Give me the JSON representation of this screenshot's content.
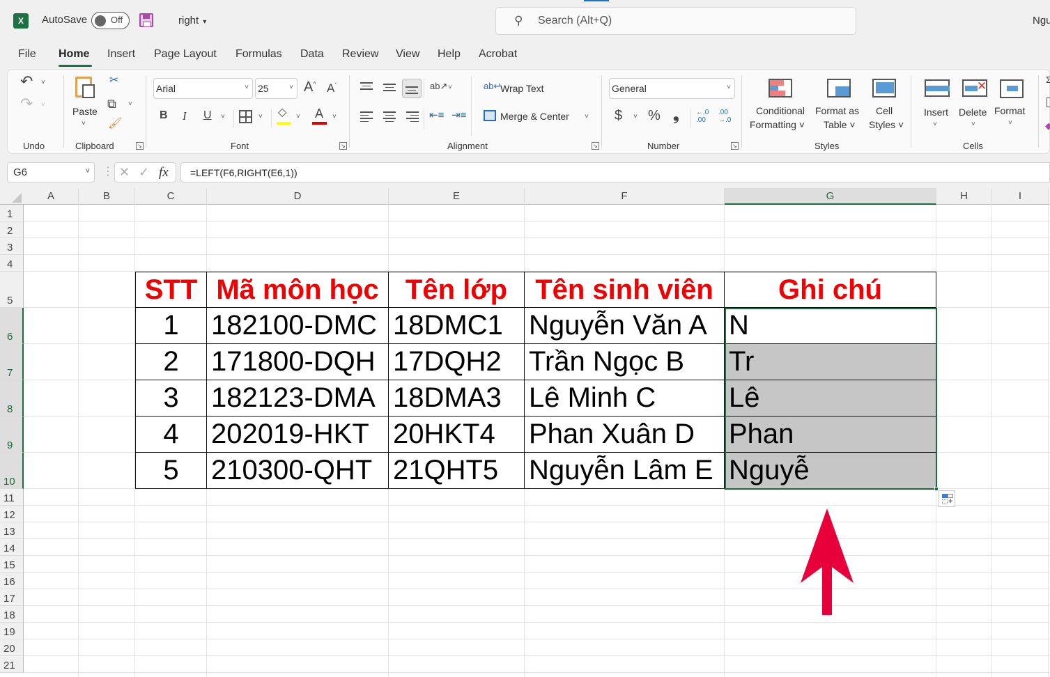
{
  "titlebar": {
    "app_icon": "excel-icon",
    "app_icon_letter": "X",
    "autosave_label": "AutoSave",
    "autosave_state": "Off",
    "save_icon": "save-icon",
    "document_name": "right",
    "document_caret": "▾",
    "search_placeholder": "Search (Alt+Q)",
    "search_icon": "⚲",
    "user_name": "Ngu"
  },
  "ribbon_tabs": [
    "File",
    "Home",
    "Insert",
    "Page Layout",
    "Formulas",
    "Data",
    "Review",
    "View",
    "Help",
    "Acrobat"
  ],
  "active_tab": "Home",
  "ribbon": {
    "undo": {
      "group_label": "Undo",
      "undo_icon": "↶",
      "redo_icon": "↷"
    },
    "clipboard": {
      "group_label": "Clipboard",
      "paste_label": "Paste",
      "cut_icon": "✂",
      "copy_icon": "⧉",
      "format_painter_icon": "🖌"
    },
    "font": {
      "group_label": "Font",
      "font_name": "Arial",
      "font_size": "25",
      "grow_icon": "A^",
      "shrink_icon": "Aˇ",
      "bold": "B",
      "italic": "I",
      "underline": "U",
      "fill_color": "#ffff00",
      "font_color": "#e00000"
    },
    "alignment": {
      "group_label": "Alignment",
      "wrap_text": "Wrap Text",
      "merge_center": "Merge & Center",
      "wrap_icon": "ab↵",
      "orientation_icon": "ab↗"
    },
    "number": {
      "group_label": "Number",
      "format": "General",
      "currency": "$",
      "percent": "%",
      "comma": "❟",
      "inc_decimal": "←.0\n.00",
      "dec_decimal": ".00\n→.0"
    },
    "styles": {
      "group_label": "Styles",
      "conditional_formatting": [
        "Conditional",
        "Formatting ˅"
      ],
      "format_as_table": [
        "Format as",
        "Table ˅"
      ],
      "cell_styles": [
        "Cell",
        "Styles ˅"
      ]
    },
    "cells": {
      "group_label": "Cells",
      "insert": "Insert",
      "delete": "Delete",
      "format": "Format"
    }
  },
  "formula_bar": {
    "name_box": "G6",
    "cancel_icon": "✕",
    "enter_icon": "✓",
    "fx_label": "fx",
    "formula": "=LEFT(F6,RIGHT(E6,1))"
  },
  "sheet": {
    "columns": [
      "A",
      "B",
      "C",
      "D",
      "E",
      "F",
      "G",
      "H",
      "I"
    ],
    "selected_column": "G",
    "rows": [
      "1",
      "2",
      "3",
      "4",
      "5",
      "6",
      "7",
      "8",
      "9",
      "10",
      "11",
      "12",
      "13",
      "14",
      "15",
      "16",
      "17",
      "18",
      "19",
      "20",
      "21"
    ],
    "selected_rows": [
      "6",
      "7",
      "8",
      "9",
      "10"
    ],
    "table": {
      "headers": [
        "STT",
        "Mã môn học",
        "Tên lớp",
        "Tên sinh viên",
        "Ghi chú"
      ],
      "rows": [
        [
          "1",
          "182100-DMC",
          "18DMC1",
          "Nguyễn Văn A",
          "N"
        ],
        [
          "2",
          "171800-DQH",
          "17DQH2",
          "Trần Ngọc B",
          "Tr"
        ],
        [
          "3",
          "182123-DMA",
          "18DMA3",
          "Lê Minh C",
          "Lê"
        ],
        [
          "4",
          "202019-HKT",
          "20HKT4",
          "Phan Xuân D",
          "Phan"
        ],
        [
          "5",
          "210300-QHT",
          "21QHT5",
          "Nguyễn Lâm E",
          "Nguyễ"
        ]
      ]
    },
    "header_color": "#f00000",
    "selection_color": "#1e6b3d",
    "highlight_fill": "#c6c6c6",
    "annotation_arrow_color": "#e8003a"
  }
}
